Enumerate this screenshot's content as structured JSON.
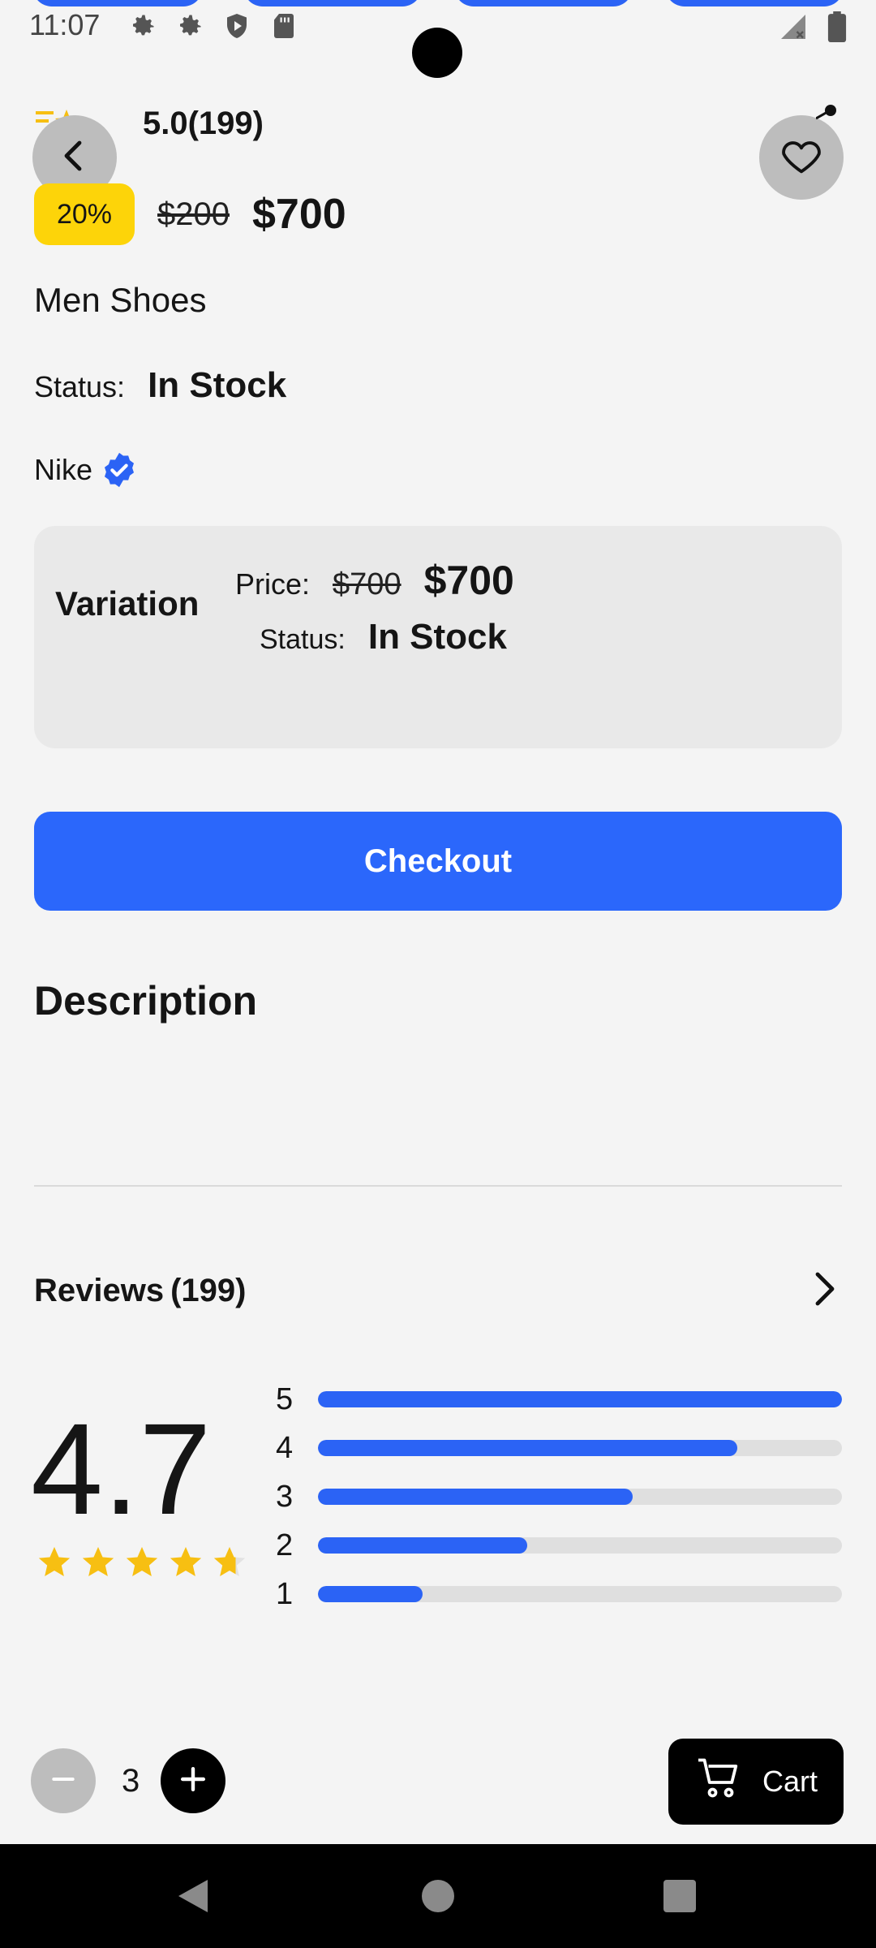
{
  "status_bar": {
    "time": "11:07"
  },
  "header": {
    "rating_text": "5.0(199)",
    "back_icon": "chevron-left-icon",
    "favorite_icon": "heart-icon"
  },
  "product": {
    "discount_badge": "20%",
    "old_price": "$200",
    "price": "$700",
    "title": "Men Shoes",
    "status_label": "Status:",
    "status_value": "In Stock",
    "brand": "Nike"
  },
  "variation": {
    "title": "Variation",
    "price_label": "Price:",
    "old_price": "$700",
    "price": "$700",
    "status_label": "Status:",
    "status_value": "In Stock"
  },
  "checkout_label": "Checkout",
  "description_title": "Description",
  "reviews": {
    "title": "Reviews",
    "count": "(199)",
    "overall": "4.7",
    "star_rating": 4.7,
    "breakdown": [
      {
        "label": "5",
        "fraction": 1.0
      },
      {
        "label": "4",
        "fraction": 0.8
      },
      {
        "label": "3",
        "fraction": 0.6
      },
      {
        "label": "2",
        "fraction": 0.4
      },
      {
        "label": "1",
        "fraction": 0.2
      }
    ]
  },
  "quantity": {
    "value": "3"
  },
  "cart_label": "Cart",
  "colors": {
    "accent": "#2b63f5",
    "badge": "#fdd409",
    "star": "#f7bf12"
  }
}
